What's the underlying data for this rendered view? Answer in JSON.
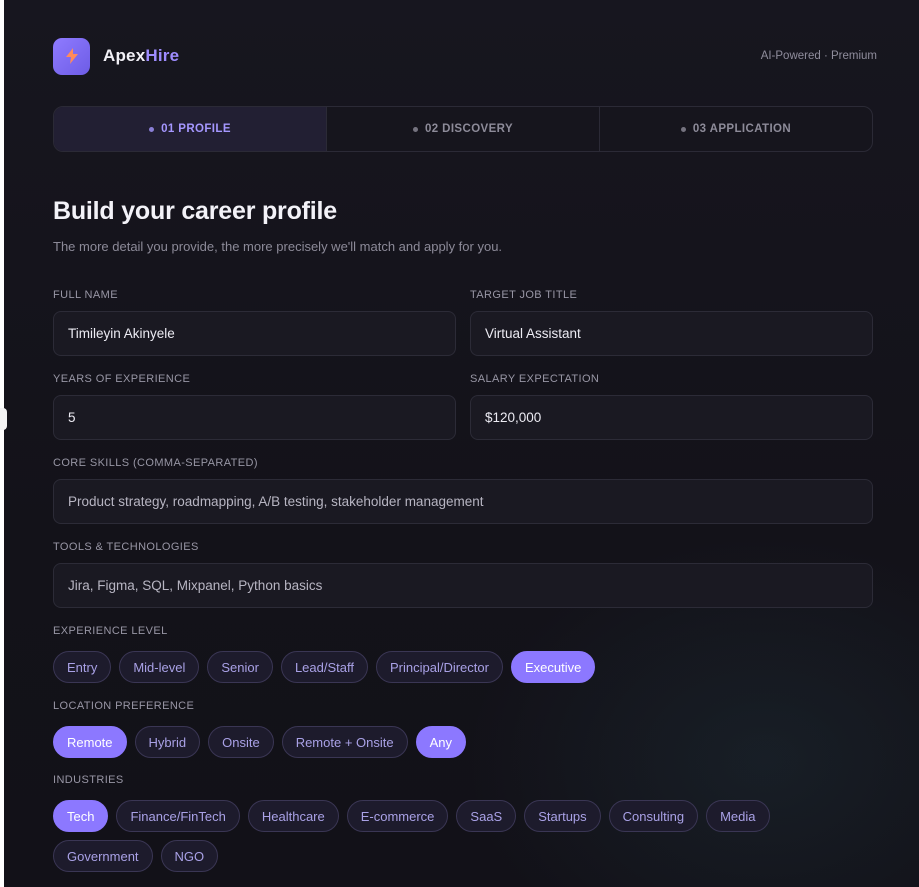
{
  "brand": {
    "name_prefix": "Apex",
    "name_accent": "Hire",
    "tagline": "AI-Powered · Premium",
    "accent_color": "#8c78ff"
  },
  "steps": [
    {
      "label": "01 PROFILE",
      "active": true
    },
    {
      "label": "02 DISCOVERY",
      "active": false
    },
    {
      "label": "03 APPLICATION",
      "active": false
    }
  ],
  "page": {
    "title": "Build your career profile",
    "subtitle": "The more detail you provide, the more precisely we'll match and apply for you."
  },
  "form": {
    "full_name": {
      "label": "FULL NAME",
      "value": "Timileyin Akinyele"
    },
    "target_title": {
      "label": "TARGET JOB TITLE",
      "value": "Virtual Assistant"
    },
    "years": {
      "label": "YEARS OF EXPERIENCE",
      "value": "5"
    },
    "salary": {
      "label": "SALARY EXPECTATION",
      "value": "$120,000"
    },
    "skills": {
      "label": "CORE SKILLS (COMMA-SEPARATED)",
      "placeholder": "Product strategy, roadmapping, A/B testing, stakeholder management"
    },
    "tools": {
      "label": "TOOLS & TECHNOLOGIES",
      "placeholder": "Jira, Figma, SQL, Mixpanel, Python basics"
    }
  },
  "experience_level": {
    "label": "EXPERIENCE LEVEL",
    "options": [
      "Entry",
      "Mid-level",
      "Senior",
      "Lead/Staff",
      "Principal/Director",
      "Executive"
    ],
    "selected": [
      "Executive"
    ]
  },
  "location": {
    "label": "LOCATION PREFERENCE",
    "options": [
      "Remote",
      "Hybrid",
      "Onsite",
      "Remote + Onsite",
      "Any"
    ],
    "selected": [
      "Remote",
      "Any"
    ]
  },
  "industries": {
    "label": "INDUSTRIES",
    "options": [
      "Tech",
      "Finance/FinTech",
      "Healthcare",
      "E-commerce",
      "SaaS",
      "Startups",
      "Consulting",
      "Media",
      "Government",
      "NGO"
    ],
    "selected": [
      "Tech"
    ]
  }
}
